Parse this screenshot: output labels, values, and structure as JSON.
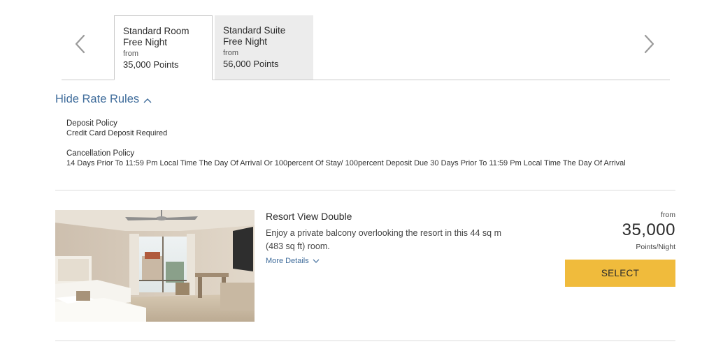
{
  "carousel": {
    "prev_icon": "chevron-left-icon",
    "next_icon": "chevron-right-icon"
  },
  "rate_tabs": [
    {
      "name_line1": "Standard Room",
      "name_line2": "Free Night",
      "from_label": "from",
      "points": "35,000 Points",
      "selected": true
    },
    {
      "name_line1": "Standard Suite",
      "name_line2": "Free Night",
      "from_label": "from",
      "points": "56,000 Points",
      "selected": false
    }
  ],
  "rate_rules": {
    "toggle_label": "Hide Rate Rules",
    "toggle_icon": "chevron-up-icon",
    "deposit": {
      "title": "Deposit Policy",
      "text": "Credit Card Deposit Required"
    },
    "cancellation": {
      "title": "Cancellation Policy",
      "text": "14 Days Prior To 11:59 Pm Local Time The Day Of Arrival Or 100percent Of Stay/ 100percent Deposit Due 30 Days Prior To 11:59 Pm Local Time The Day Of Arrival"
    }
  },
  "room": {
    "title": "Resort View Double",
    "description": "Enjoy a private balcony overlooking the resort in this 44 sq m (483 sq ft) room.",
    "more_details_label": "More Details",
    "more_details_icon": "chevron-down-icon",
    "price_from_label": "from",
    "price": "35,000",
    "price_unit": "Points/Night",
    "select_label": "SELECT"
  },
  "colors": {
    "link_blue": "#3f6c9b",
    "select_yellow": "#f0bb3c",
    "inactive_tab": "#ececec"
  }
}
